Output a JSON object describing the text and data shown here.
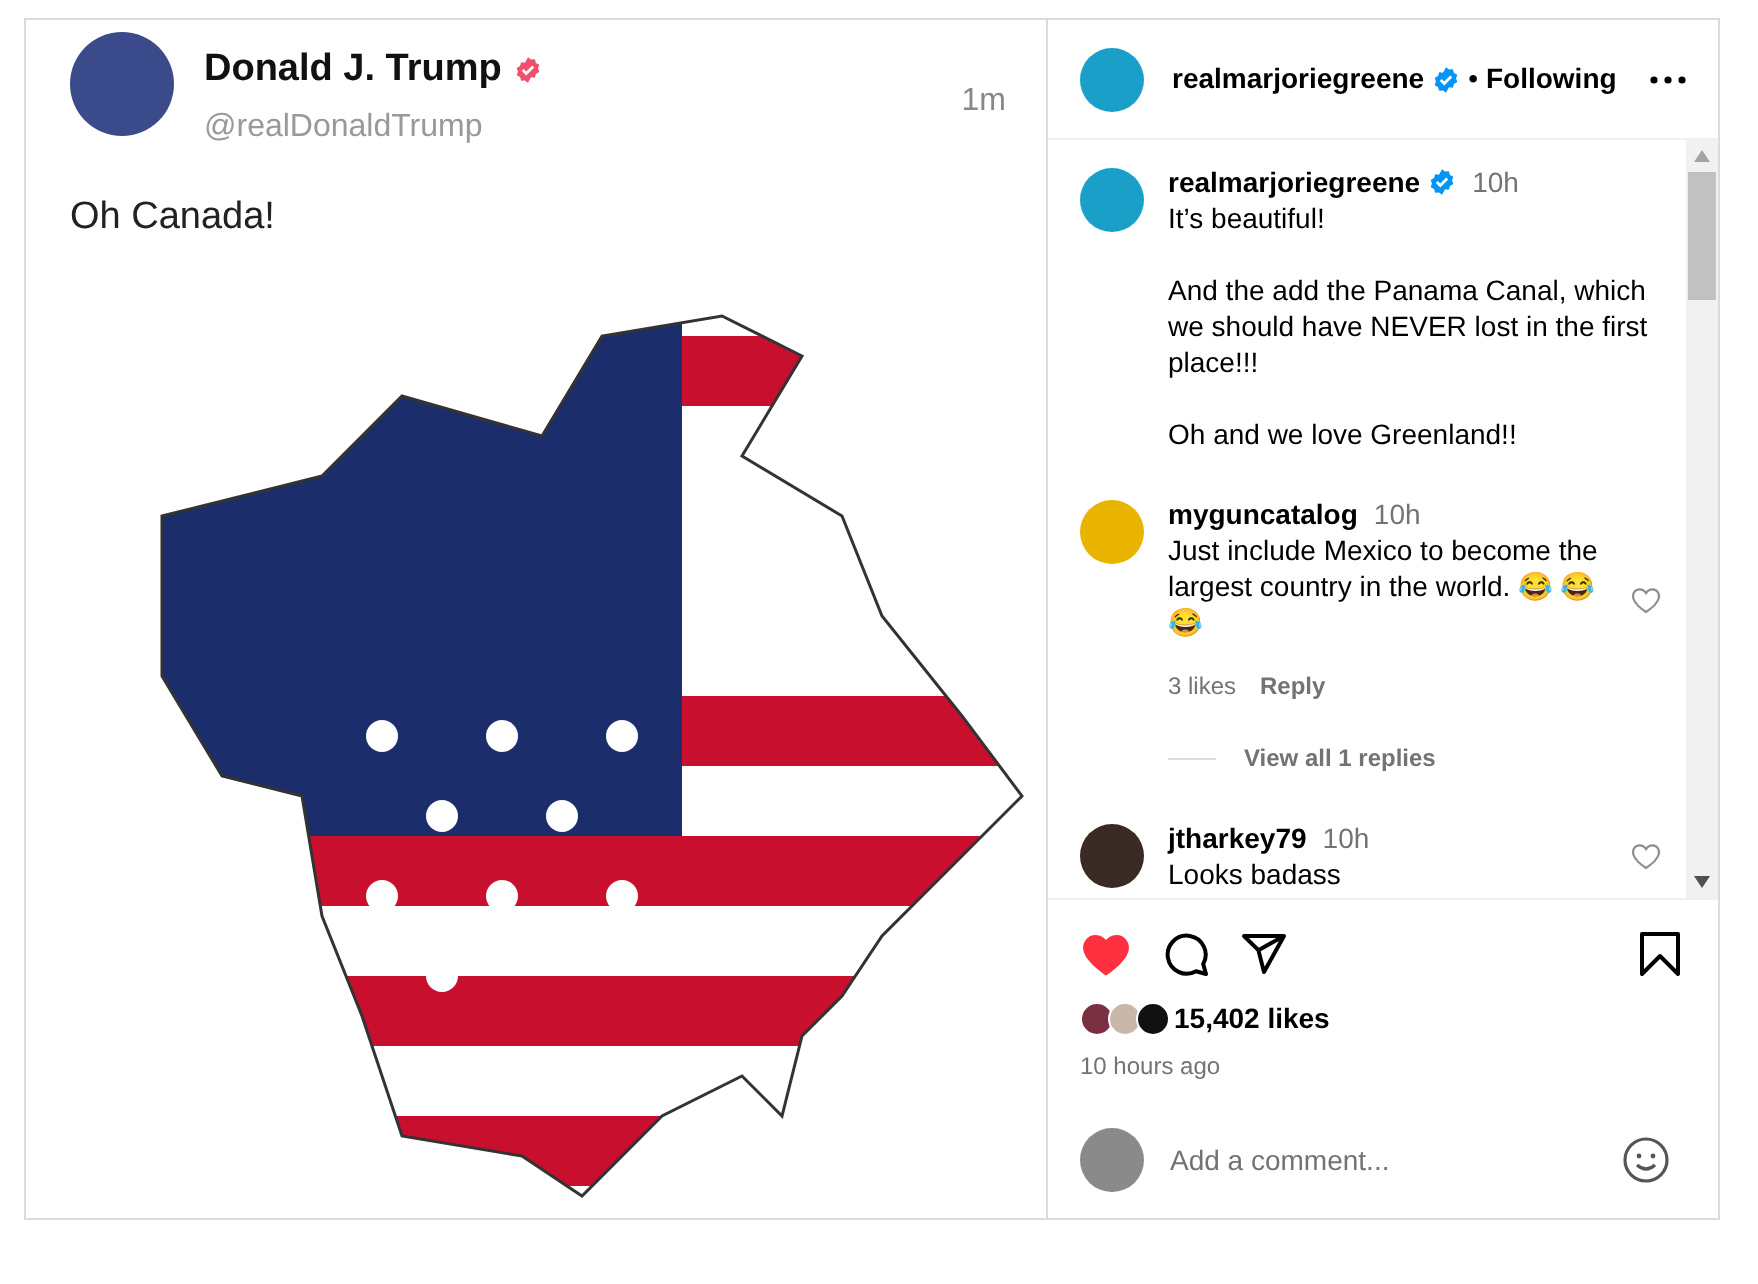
{
  "post": {
    "author": {
      "name": "Donald J. Trump",
      "handle": "@realDonaldTrump",
      "verified": true
    },
    "time": "1m",
    "text": "Oh Canada!"
  },
  "header": {
    "username": "realmarjoriegreene",
    "verified": true,
    "separator": "•",
    "follow_status": "Following"
  },
  "comments": [
    {
      "kind": "caption",
      "username": "realmarjoriegreene",
      "verified": true,
      "time": "10h",
      "paragraphs": [
        "It’s beautiful!",
        "And the add the Panama Canal, which we should have NEVER lost in the first place!!!",
        "Oh and we love Greenland!!"
      ]
    },
    {
      "kind": "comment",
      "username": "myguncatalog",
      "time": "10h",
      "paragraphs": [
        "Just include Mexico to become the largest country in the world. 😂 😂 😂"
      ],
      "likes": "3 likes",
      "reply": "Reply",
      "view_replies": "View all 1 replies"
    },
    {
      "kind": "comment",
      "username": "jtharkey79",
      "time": "10h",
      "paragraphs": [
        "Looks badass"
      ]
    }
  ],
  "actions": {
    "liked": true,
    "saved": false
  },
  "likes": "15,402 likes",
  "posted": "10 hours ago",
  "comment_field": {
    "placeholder": "Add a comment..."
  }
}
